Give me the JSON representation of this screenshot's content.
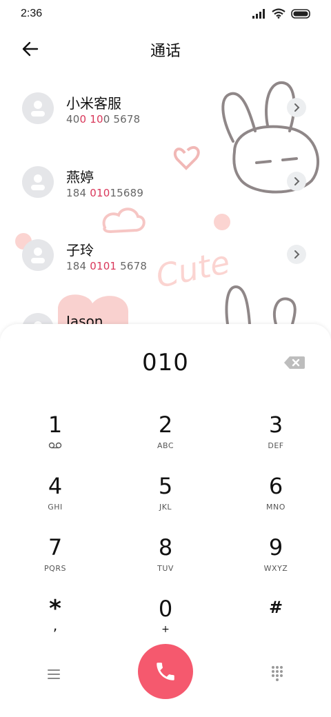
{
  "status_bar": {
    "time": "2:36"
  },
  "header": {
    "title": "通话"
  },
  "contacts": [
    {
      "name": "小米客服",
      "number_parts": [
        "40",
        "0 10",
        "0 5678"
      ]
    },
    {
      "name": "燕婷",
      "number_parts": [
        "184 ",
        "010",
        "15689"
      ]
    },
    {
      "name": "子玲",
      "number_parts": [
        "184 ",
        "0101",
        " 5678"
      ]
    },
    {
      "name": "Jason",
      "number_parts": [
        "",
        "",
        ""
      ]
    }
  ],
  "decor_text": "Cute",
  "dialer": {
    "input_value": "010",
    "keys": [
      {
        "digit": "1",
        "letters": ""
      },
      {
        "digit": "2",
        "letters": "ABC"
      },
      {
        "digit": "3",
        "letters": "DEF"
      },
      {
        "digit": "4",
        "letters": "GHI"
      },
      {
        "digit": "5",
        "letters": "JKL"
      },
      {
        "digit": "6",
        "letters": "MNO"
      },
      {
        "digit": "7",
        "letters": "PQRS"
      },
      {
        "digit": "8",
        "letters": "TUV"
      },
      {
        "digit": "9",
        "letters": "WXYZ"
      },
      {
        "digit": "*",
        "letters": ","
      },
      {
        "digit": "0",
        "letters": "+"
      },
      {
        "digit": "#",
        "letters": ""
      }
    ]
  },
  "colors": {
    "accent": "#d9375a",
    "call_button": "#f5596e",
    "avatar_bg": "#e5e6e9"
  },
  "icons": {
    "back": "arrow-left-icon",
    "delete": "backspace-icon",
    "voicemail": "voicemail-icon",
    "menu": "menu-icon",
    "call": "phone-icon",
    "keypad": "dialpad-icon",
    "chevron": "chevron-right-icon"
  }
}
